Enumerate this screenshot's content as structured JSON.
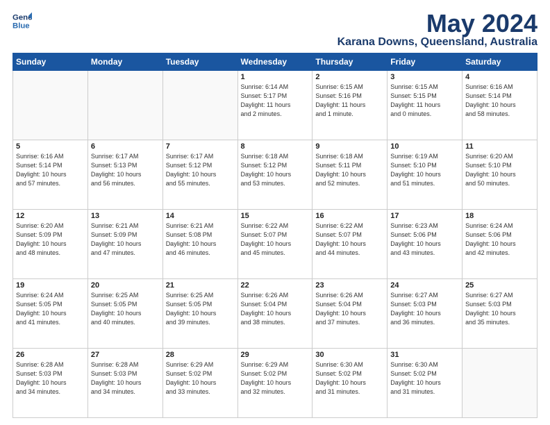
{
  "header": {
    "logo_line1": "General",
    "logo_line2": "Blue",
    "month_title": "May 2024",
    "location": "Karana Downs, Queensland, Australia"
  },
  "days_of_week": [
    "Sunday",
    "Monday",
    "Tuesday",
    "Wednesday",
    "Thursday",
    "Friday",
    "Saturday"
  ],
  "weeks": [
    [
      {
        "day": "",
        "info": ""
      },
      {
        "day": "",
        "info": ""
      },
      {
        "day": "",
        "info": ""
      },
      {
        "day": "1",
        "info": "Sunrise: 6:14 AM\nSunset: 5:17 PM\nDaylight: 11 hours\nand 2 minutes."
      },
      {
        "day": "2",
        "info": "Sunrise: 6:15 AM\nSunset: 5:16 PM\nDaylight: 11 hours\nand 1 minute."
      },
      {
        "day": "3",
        "info": "Sunrise: 6:15 AM\nSunset: 5:15 PM\nDaylight: 11 hours\nand 0 minutes."
      },
      {
        "day": "4",
        "info": "Sunrise: 6:16 AM\nSunset: 5:14 PM\nDaylight: 10 hours\nand 58 minutes."
      }
    ],
    [
      {
        "day": "5",
        "info": "Sunrise: 6:16 AM\nSunset: 5:14 PM\nDaylight: 10 hours\nand 57 minutes."
      },
      {
        "day": "6",
        "info": "Sunrise: 6:17 AM\nSunset: 5:13 PM\nDaylight: 10 hours\nand 56 minutes."
      },
      {
        "day": "7",
        "info": "Sunrise: 6:17 AM\nSunset: 5:12 PM\nDaylight: 10 hours\nand 55 minutes."
      },
      {
        "day": "8",
        "info": "Sunrise: 6:18 AM\nSunset: 5:12 PM\nDaylight: 10 hours\nand 53 minutes."
      },
      {
        "day": "9",
        "info": "Sunrise: 6:18 AM\nSunset: 5:11 PM\nDaylight: 10 hours\nand 52 minutes."
      },
      {
        "day": "10",
        "info": "Sunrise: 6:19 AM\nSunset: 5:10 PM\nDaylight: 10 hours\nand 51 minutes."
      },
      {
        "day": "11",
        "info": "Sunrise: 6:20 AM\nSunset: 5:10 PM\nDaylight: 10 hours\nand 50 minutes."
      }
    ],
    [
      {
        "day": "12",
        "info": "Sunrise: 6:20 AM\nSunset: 5:09 PM\nDaylight: 10 hours\nand 48 minutes."
      },
      {
        "day": "13",
        "info": "Sunrise: 6:21 AM\nSunset: 5:09 PM\nDaylight: 10 hours\nand 47 minutes."
      },
      {
        "day": "14",
        "info": "Sunrise: 6:21 AM\nSunset: 5:08 PM\nDaylight: 10 hours\nand 46 minutes."
      },
      {
        "day": "15",
        "info": "Sunrise: 6:22 AM\nSunset: 5:07 PM\nDaylight: 10 hours\nand 45 minutes."
      },
      {
        "day": "16",
        "info": "Sunrise: 6:22 AM\nSunset: 5:07 PM\nDaylight: 10 hours\nand 44 minutes."
      },
      {
        "day": "17",
        "info": "Sunrise: 6:23 AM\nSunset: 5:06 PM\nDaylight: 10 hours\nand 43 minutes."
      },
      {
        "day": "18",
        "info": "Sunrise: 6:24 AM\nSunset: 5:06 PM\nDaylight: 10 hours\nand 42 minutes."
      }
    ],
    [
      {
        "day": "19",
        "info": "Sunrise: 6:24 AM\nSunset: 5:05 PM\nDaylight: 10 hours\nand 41 minutes."
      },
      {
        "day": "20",
        "info": "Sunrise: 6:25 AM\nSunset: 5:05 PM\nDaylight: 10 hours\nand 40 minutes."
      },
      {
        "day": "21",
        "info": "Sunrise: 6:25 AM\nSunset: 5:05 PM\nDaylight: 10 hours\nand 39 minutes."
      },
      {
        "day": "22",
        "info": "Sunrise: 6:26 AM\nSunset: 5:04 PM\nDaylight: 10 hours\nand 38 minutes."
      },
      {
        "day": "23",
        "info": "Sunrise: 6:26 AM\nSunset: 5:04 PM\nDaylight: 10 hours\nand 37 minutes."
      },
      {
        "day": "24",
        "info": "Sunrise: 6:27 AM\nSunset: 5:03 PM\nDaylight: 10 hours\nand 36 minutes."
      },
      {
        "day": "25",
        "info": "Sunrise: 6:27 AM\nSunset: 5:03 PM\nDaylight: 10 hours\nand 35 minutes."
      }
    ],
    [
      {
        "day": "26",
        "info": "Sunrise: 6:28 AM\nSunset: 5:03 PM\nDaylight: 10 hours\nand 34 minutes."
      },
      {
        "day": "27",
        "info": "Sunrise: 6:28 AM\nSunset: 5:03 PM\nDaylight: 10 hours\nand 34 minutes."
      },
      {
        "day": "28",
        "info": "Sunrise: 6:29 AM\nSunset: 5:02 PM\nDaylight: 10 hours\nand 33 minutes."
      },
      {
        "day": "29",
        "info": "Sunrise: 6:29 AM\nSunset: 5:02 PM\nDaylight: 10 hours\nand 32 minutes."
      },
      {
        "day": "30",
        "info": "Sunrise: 6:30 AM\nSunset: 5:02 PM\nDaylight: 10 hours\nand 31 minutes."
      },
      {
        "day": "31",
        "info": "Sunrise: 6:30 AM\nSunset: 5:02 PM\nDaylight: 10 hours\nand 31 minutes."
      },
      {
        "day": "",
        "info": ""
      }
    ]
  ]
}
